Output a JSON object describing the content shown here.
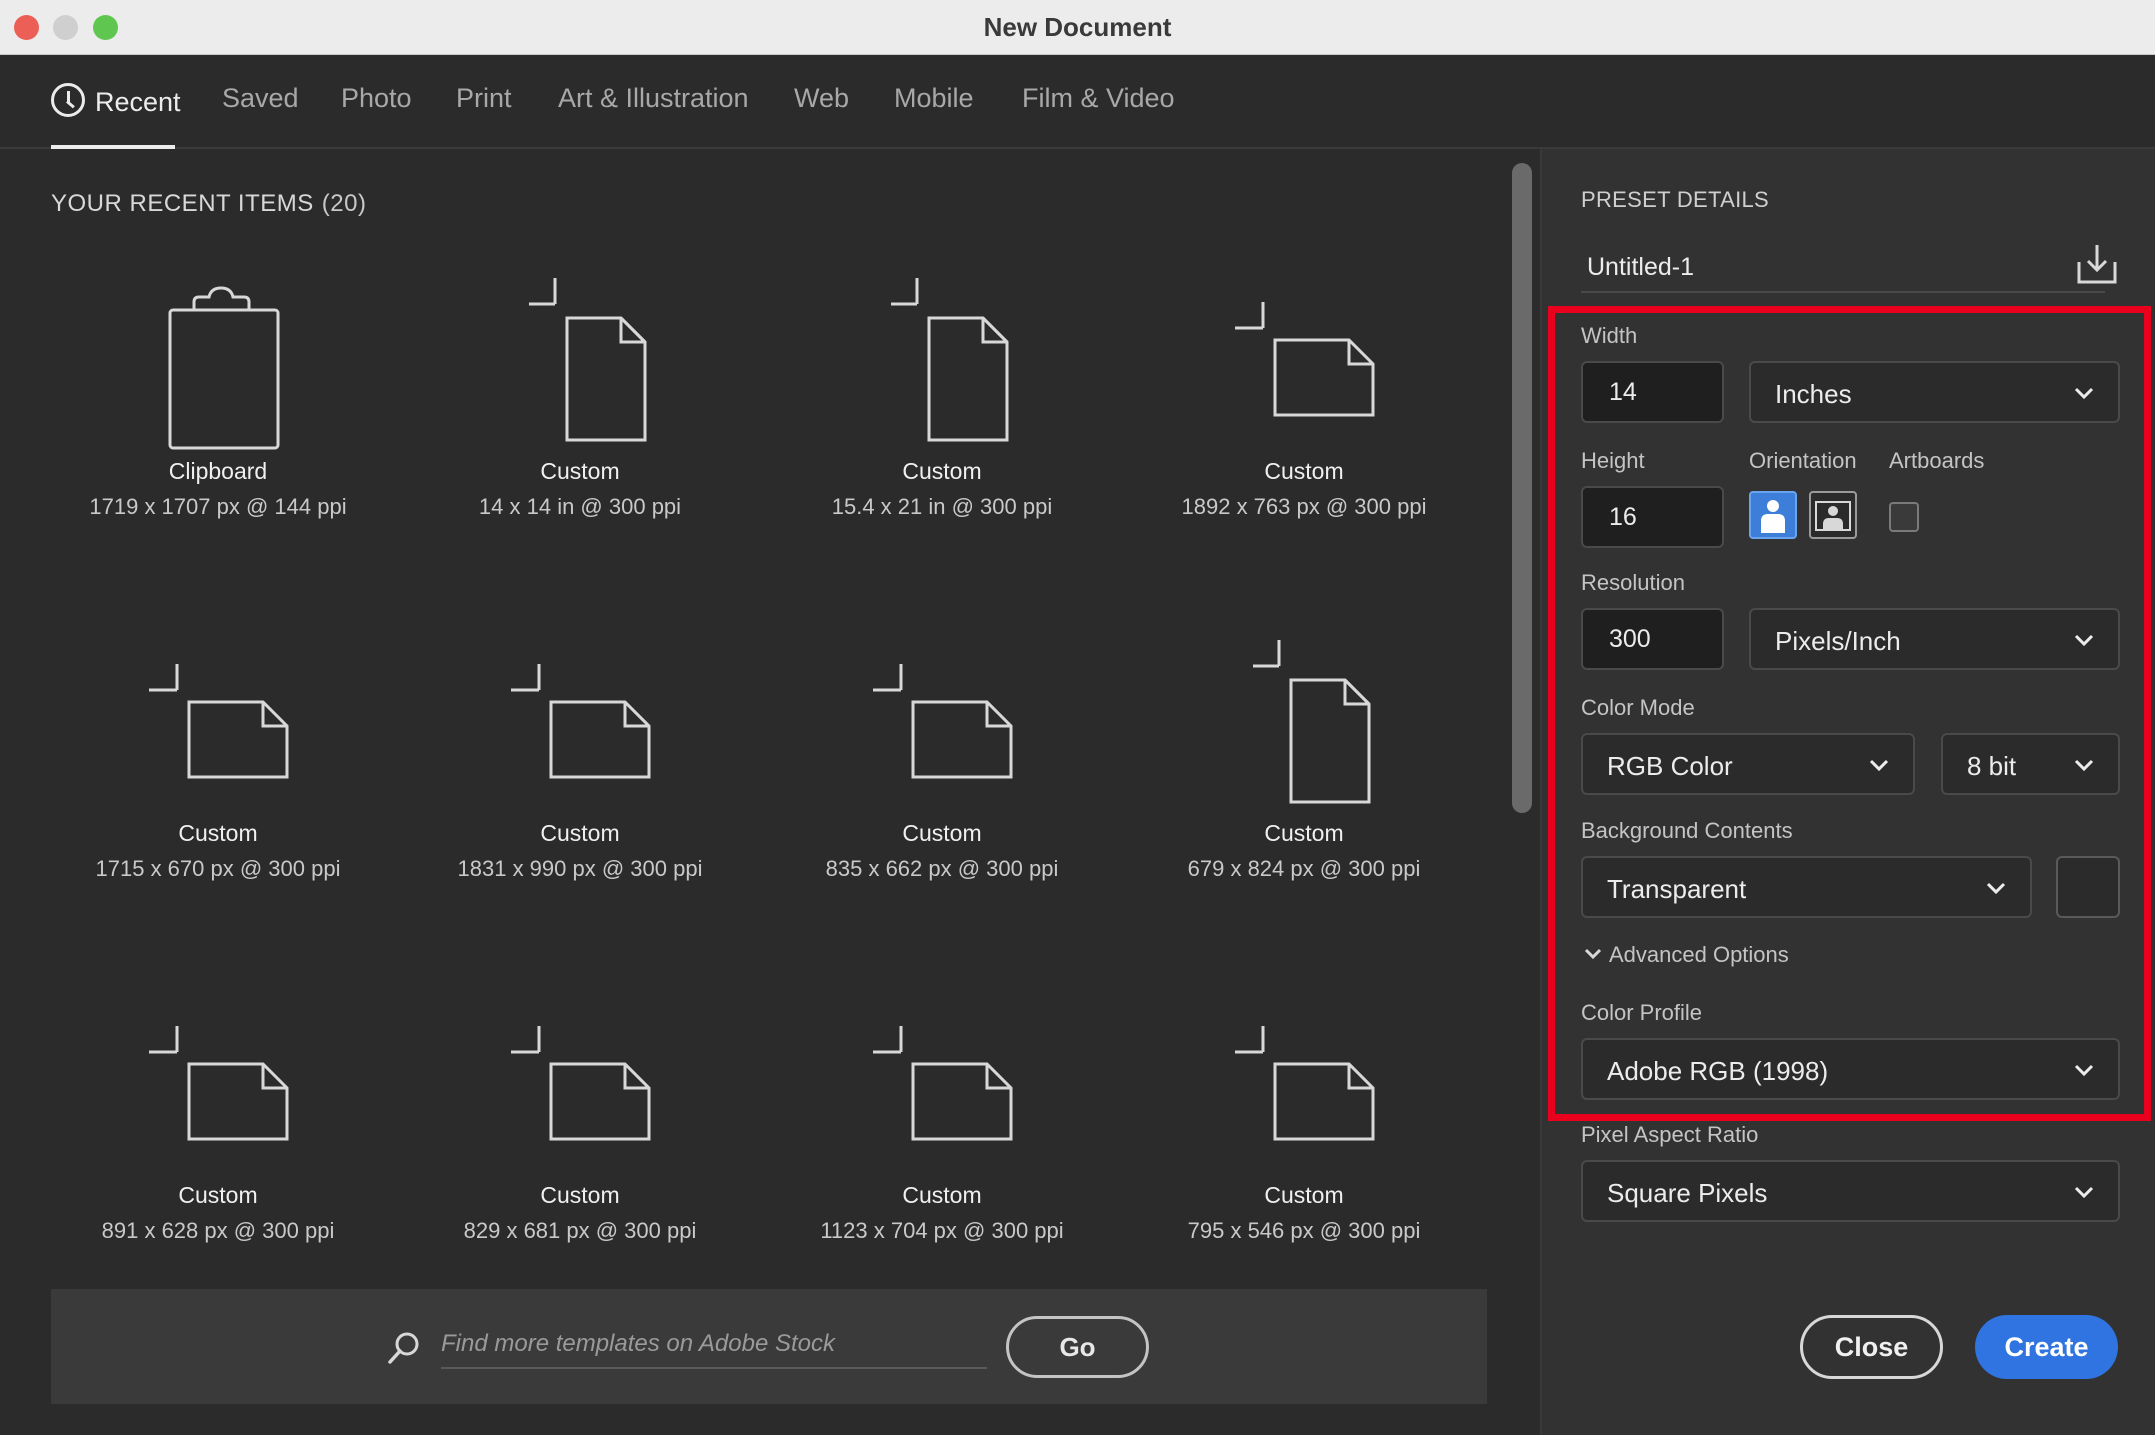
{
  "window": {
    "title": "New Document"
  },
  "tabs": [
    {
      "label": "Recent",
      "active": true
    },
    {
      "label": "Saved"
    },
    {
      "label": "Photo"
    },
    {
      "label": "Print"
    },
    {
      "label": "Art & Illustration"
    },
    {
      "label": "Web"
    },
    {
      "label": "Mobile"
    },
    {
      "label": "Film & Video"
    }
  ],
  "recent": {
    "header": "YOUR RECENT ITEMS",
    "count": "(20)",
    "items": [
      {
        "name": "Clipboard",
        "dims": "1719 x 1707 px @ 144 ppi",
        "icon": "clipboard-icon"
      },
      {
        "name": "Custom",
        "dims": "14 x 14 in @ 300 ppi",
        "icon": "document-portrait-icon"
      },
      {
        "name": "Custom",
        "dims": "15.4 x 21 in @ 300 ppi",
        "icon": "document-portrait-icon"
      },
      {
        "name": "Custom",
        "dims": "1892 x 763 px @ 300 ppi",
        "icon": "document-landscape-icon"
      },
      {
        "name": "Custom",
        "dims": "1715 x 670 px @ 300 ppi",
        "icon": "document-landscape-icon"
      },
      {
        "name": "Custom",
        "dims": "1831 x 990 px @ 300 ppi",
        "icon": "document-landscape-icon"
      },
      {
        "name": "Custom",
        "dims": "835 x 662 px @ 300 ppi",
        "icon": "document-landscape-icon"
      },
      {
        "name": "Custom",
        "dims": "679 x 824 px @ 300 ppi",
        "icon": "document-portrait-icon"
      },
      {
        "name": "Custom",
        "dims": "891 x 628 px @ 300 ppi",
        "icon": "document-landscape-icon"
      },
      {
        "name": "Custom",
        "dims": "829 x 681 px @ 300 ppi",
        "icon": "document-landscape-icon"
      },
      {
        "name": "Custom",
        "dims": "1123 x 704 px @ 300 ppi",
        "icon": "document-landscape-icon"
      },
      {
        "name": "Custom",
        "dims": "795 x 546 px @ 300 ppi",
        "icon": "document-landscape-icon"
      }
    ]
  },
  "stock": {
    "placeholder": "Find more templates on Adobe Stock",
    "go_label": "Go"
  },
  "preset": {
    "title": "PRESET DETAILS",
    "doc_name": "Untitled-1",
    "width_label": "Width",
    "width_value": "14",
    "width_unit": "Inches",
    "height_label": "Height",
    "height_value": "16",
    "orientation_label": "Orientation",
    "orientation": "portrait",
    "artboards_label": "Artboards",
    "artboards_checked": false,
    "resolution_label": "Resolution",
    "resolution_value": "300",
    "resolution_unit": "Pixels/Inch",
    "color_mode_label": "Color Mode",
    "color_mode": "RGB Color",
    "bit_depth": "8 bit",
    "background_label": "Background Contents",
    "background": "Transparent",
    "advanced_label": "Advanced Options",
    "color_profile_label": "Color Profile",
    "color_profile": "Adobe RGB (1998)",
    "pixel_aspect_label": "Pixel Aspect Ratio",
    "pixel_aspect": "Square Pixels"
  },
  "actions": {
    "close_label": "Close",
    "create_label": "Create"
  },
  "colors": {
    "accent": "#2f74e0",
    "highlight": "#e8001c",
    "background": "#2b2b2b"
  }
}
